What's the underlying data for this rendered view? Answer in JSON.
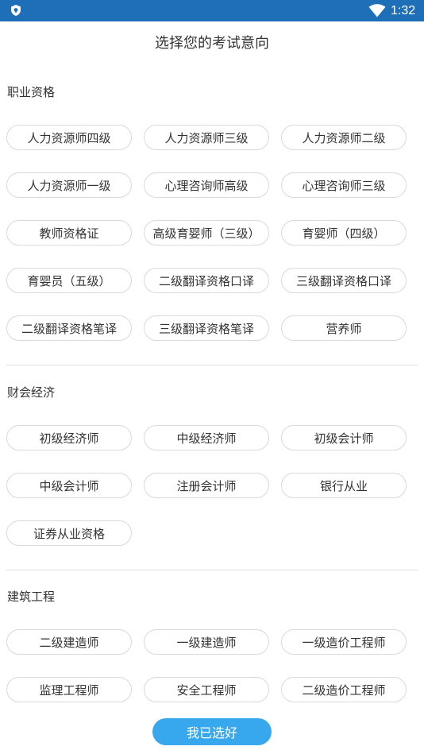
{
  "status_bar": {
    "time": "1:32",
    "icons": [
      "shield-icon",
      "wifi-icon"
    ]
  },
  "header": {
    "title": "选择您的考试意向"
  },
  "sections": [
    {
      "title": "职业资格",
      "options": [
        "人力资源师四级",
        "人力资源师三级",
        "人力资源师二级",
        "人力资源师一级",
        "心理咨询师高级",
        "心理咨询师三级",
        "教师资格证",
        "高级育婴师（三级）",
        "育婴师（四级）",
        "育婴员（五级）",
        "二级翻译资格口译",
        "三级翻译资格口译",
        "二级翻译资格笔译",
        "三级翻译资格笔译",
        "营养师"
      ]
    },
    {
      "title": "财会经济",
      "options": [
        "初级经济师",
        "中级经济师",
        "初级会计师",
        "中级会计师",
        "注册会计师",
        "银行从业",
        "证券从业资格"
      ]
    },
    {
      "title": "建筑工程",
      "options": [
        "二级建造师",
        "一级建造师",
        "一级造价工程师",
        "监理工程师",
        "安全工程师",
        "二级造价工程师"
      ]
    }
  ],
  "confirm_button": {
    "label": "我已选好"
  },
  "colors": {
    "status_bar": "#1e6fb8",
    "button": "#38a8ee",
    "chip_border": "#d9d9d9",
    "text": "#333333"
  }
}
